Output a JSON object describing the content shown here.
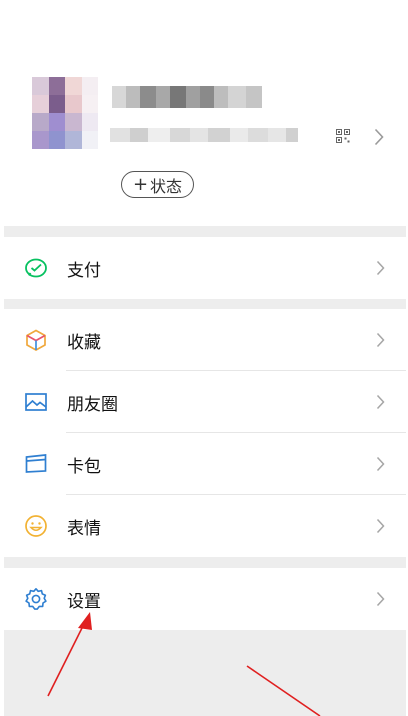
{
  "profile": {
    "status_plus": "+",
    "status_label": "状态",
    "avatar_pixels": [
      "#d9c9d9",
      "#8d6e98",
      "#f0d7d6",
      "#f4eef2",
      "#e6cfd9",
      "#7b5d8c",
      "#e8c8cc",
      "#f6f0f3",
      "#b8a9c9",
      "#9f8ed0",
      "#c9b7d0",
      "#eee9f2",
      "#a997cc",
      "#8f93cf",
      "#b0b6d8",
      "#f1f1f6"
    ],
    "nick_blocks": [
      "#d7d7d7",
      "#bcbcbc",
      "#8c8c8c",
      "#a8a8a8",
      "#777777",
      "#a0a0a0",
      "#8a8a8a",
      "#bdbdbd",
      "#d4d4d4",
      "#c5c5c5"
    ],
    "id_blocks": [
      "#e1e1e1",
      "#cfcfcf",
      "#eeeeee",
      "#d8d8d8",
      "#e4e4e4",
      "#d2d2d2",
      "#eaeaea",
      "#dcdcdc",
      "#e6e6e6",
      "#d0d0d0"
    ]
  },
  "menu": {
    "pay": {
      "label": "支付",
      "icon": "wechat-pay-icon"
    },
    "favorites": {
      "label": "收藏",
      "icon": "cube-icon"
    },
    "moments": {
      "label": "朋友圈",
      "icon": "image-icon"
    },
    "cards": {
      "label": "卡包",
      "icon": "card-icon"
    },
    "stickers": {
      "label": "表情",
      "icon": "smiley-icon"
    },
    "settings": {
      "label": "设置",
      "icon": "gear-icon"
    }
  },
  "colors": {
    "pay_green": "#07c160",
    "favorites_orange": "#f0a83c",
    "blue": "#2f7fd1",
    "sticker_yellow": "#f2b233",
    "annotation_red": "#e02020",
    "gap_gray": "#ededed"
  }
}
